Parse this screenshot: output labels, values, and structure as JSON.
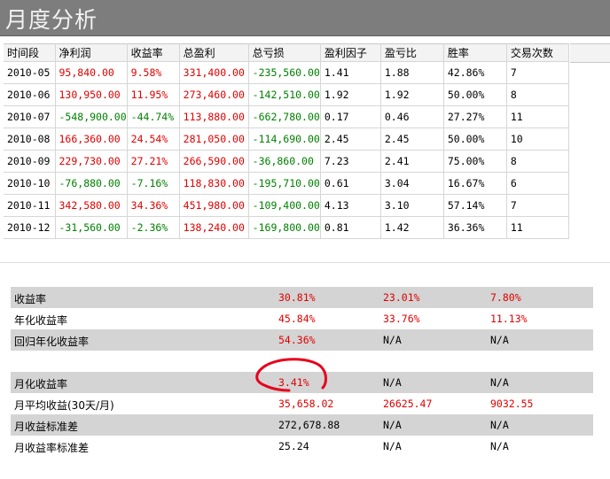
{
  "header": {
    "title": "月度分析"
  },
  "table": {
    "columns": [
      "时间段",
      "净利润",
      "收益率",
      "总盈利",
      "总亏损",
      "盈利因子",
      "盈亏比",
      "胜率",
      "交易次数"
    ],
    "rows": [
      [
        "2010-05",
        "95,840.00",
        "9.58%",
        "331,400.00",
        "-235,560.00",
        "1.41",
        "1.88",
        "42.86%",
        "7"
      ],
      [
        "2010-06",
        "130,950.00",
        "11.95%",
        "273,460.00",
        "-142,510.00",
        "1.92",
        "1.92",
        "50.00%",
        "8"
      ],
      [
        "2010-07",
        "-548,900.00",
        "-44.74%",
        "113,880.00",
        "-662,780.00",
        "0.17",
        "0.46",
        "27.27%",
        "11"
      ],
      [
        "2010-08",
        "166,360.00",
        "24.54%",
        "281,050.00",
        "-114,690.00",
        "2.45",
        "2.45",
        "50.00%",
        "10"
      ],
      [
        "2010-09",
        "229,730.00",
        "27.21%",
        "266,590.00",
        "-36,860.00",
        "7.23",
        "2.41",
        "75.00%",
        "8"
      ],
      [
        "2010-10",
        "-76,880.00",
        "-7.16%",
        "118,830.00",
        "-195,710.00",
        "0.61",
        "3.04",
        "16.67%",
        "6"
      ],
      [
        "2010-11",
        "342,580.00",
        "34.36%",
        "451,980.00",
        "-109,400.00",
        "4.13",
        "3.10",
        "57.14%",
        "7"
      ],
      [
        "2010-12",
        "-31,560.00",
        "-2.36%",
        "138,240.00",
        "-169,800.00",
        "0.81",
        "1.42",
        "36.36%",
        "11"
      ]
    ]
  },
  "stats": {
    "rows": [
      {
        "label": "收益率",
        "v1": "30.81%",
        "v2": "23.01%",
        "v3": "7.80%"
      },
      {
        "label": "年化收益率",
        "v1": "45.84%",
        "v2": "33.76%",
        "v3": "11.13%"
      },
      {
        "label": "回归年化收益率",
        "v1": "54.36%",
        "v2": "N/A",
        "v3": "N/A"
      },
      {
        "label": "",
        "v1": "",
        "v2": "",
        "v3": ""
      },
      {
        "label": "月化收益率",
        "v1": "3.41%",
        "v2": "N/A",
        "v3": "N/A"
      },
      {
        "label": "月平均收益(30天/月)",
        "v1": "35,658.02",
        "v2": "26625.47",
        "v3": "9032.55"
      },
      {
        "label": "月收益标准差",
        "v1": "272,678.88",
        "v2": "N/A",
        "v3": "N/A"
      },
      {
        "label": "月收益率标准差",
        "v1": "25.24",
        "v2": "N/A",
        "v3": "N/A"
      }
    ]
  },
  "colors": {
    "positive": "#e00000",
    "negative": "#008000",
    "annotation": "#e8001c"
  }
}
